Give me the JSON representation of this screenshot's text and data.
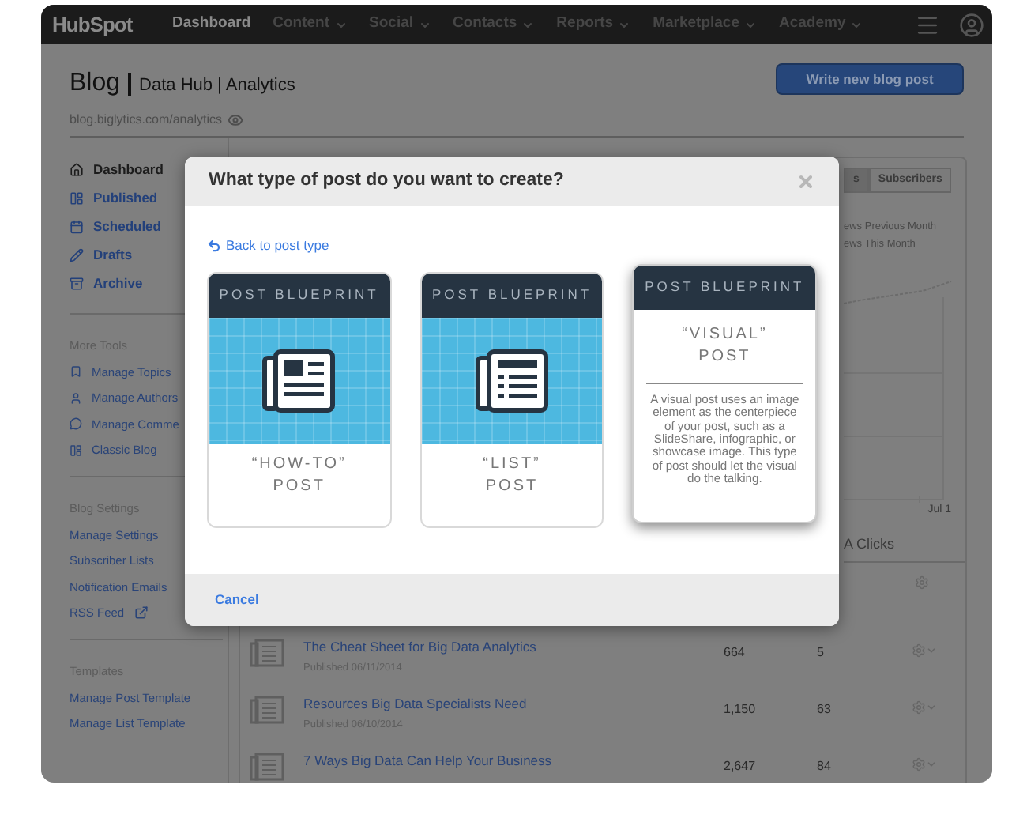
{
  "nav": {
    "logo": "HubSpot",
    "items": [
      {
        "label": "Dashboard",
        "selected": true,
        "dropdown": false
      },
      {
        "label": "Content",
        "selected": false,
        "dropdown": true
      },
      {
        "label": "Social",
        "selected": false,
        "dropdown": true
      },
      {
        "label": "Contacts",
        "selected": false,
        "dropdown": true
      },
      {
        "label": "Reports",
        "selected": false,
        "dropdown": true
      },
      {
        "label": "Marketplace",
        "selected": false,
        "dropdown": true
      },
      {
        "label": "Academy",
        "selected": false,
        "dropdown": true
      }
    ]
  },
  "header": {
    "title": "Blog",
    "subtitle": "Data Hub | Analytics",
    "url": "blog.biglytics.com/analytics",
    "button": "Write new blog post"
  },
  "sidebar": {
    "nav": [
      {
        "label": "Dashboard",
        "selected": true
      },
      {
        "label": "Published",
        "selected": false
      },
      {
        "label": "Scheduled",
        "selected": false
      },
      {
        "label": "Drafts",
        "selected": false
      },
      {
        "label": "Archive",
        "selected": false
      }
    ],
    "sections": [
      {
        "heading": "More Tools",
        "items": [
          {
            "label": "Manage Topics"
          },
          {
            "label": "Manage Authors"
          },
          {
            "label": "Manage Comme"
          },
          {
            "label": "Classic Blog"
          }
        ]
      },
      {
        "heading": "Blog Settings",
        "items": [
          {
            "label": "Manage Settings",
            "kind": "plain"
          },
          {
            "label": "Subscriber Lists",
            "kind": "plain"
          },
          {
            "label": "Notification Emails",
            "kind": "plain"
          },
          {
            "label": "RSS Feed",
            "kind": "external"
          }
        ]
      },
      {
        "heading": "Templates",
        "items": [
          {
            "label": "Manage Post Template"
          },
          {
            "label": "Manage List Template"
          }
        ]
      }
    ]
  },
  "panel": {
    "tabs": [
      {
        "label": "s",
        "selected": true
      },
      {
        "label": "Subscribers",
        "selected": false
      }
    ],
    "legend": [
      "ews Previous Month",
      "ews This Month"
    ],
    "x_label": "Jul 1",
    "column_heading": "A Clicks",
    "rows": [
      {
        "title": "The Cheat Sheet for Big Data Analytics",
        "date": "Published 06/11/2014",
        "views": "664",
        "clicks": "5"
      },
      {
        "title": "Resources Big Data Specialists Need",
        "date": "Published 06/10/2014",
        "views": "1,150",
        "clicks": "63"
      },
      {
        "title": "7 Ways Big Data Can Help Your Business",
        "views": "2,647",
        "clicks": "84"
      }
    ]
  },
  "modal": {
    "title": "What type of post do you want to create?",
    "back": "Back to post type",
    "cancel": "Cancel",
    "cards": [
      {
        "kind": "icon",
        "badge": "POST BLUEPRINT",
        "name": "“HOW-TO”\nPOST",
        "selected": false
      },
      {
        "kind": "icon",
        "badge": "POST BLUEPRINT",
        "name": "“LIST”\nPOST",
        "selected": false
      },
      {
        "kind": "description",
        "badge": "POST BLUEPRINT",
        "name": "“VISUAL”\nPOST",
        "description": "A visual post uses an image element as the centerpiece of your post, such as a SlideShare, infographic, or showcase image. This type of post should let the visual do the talking.",
        "selected": true
      }
    ]
  }
}
